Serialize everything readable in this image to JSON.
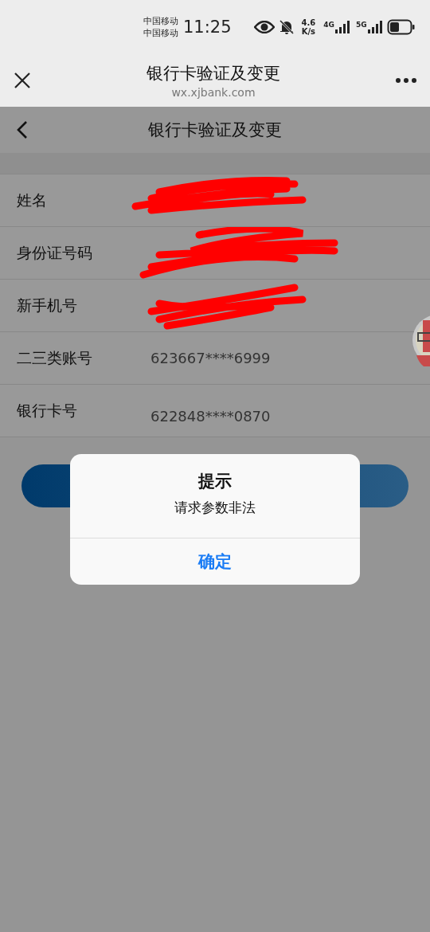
{
  "status_bar": {
    "carriers": [
      "中国移动",
      "中国移动"
    ],
    "time": "11:25",
    "speed": "4.6",
    "speed_unit": "K/s",
    "networks": [
      "4G",
      "5G"
    ]
  },
  "browser_bar": {
    "title": "银行卡验证及变更",
    "url": "wx.xjbank.com"
  },
  "nav": {
    "title": "银行卡验证及变更"
  },
  "rows": [
    {
      "label": "姓名",
      "redacted": true
    },
    {
      "label": "身份证号码",
      "redacted": true
    },
    {
      "label": "新手机号",
      "redacted": true
    },
    {
      "label": "二三类账号",
      "value": "623667****6999",
      "redacted": false
    },
    {
      "label": "银行卡号",
      "value": "622848****0870",
      "redacted": false
    }
  ],
  "dialog": {
    "title": "提示",
    "message": "请求参数非法",
    "button": "确定"
  }
}
